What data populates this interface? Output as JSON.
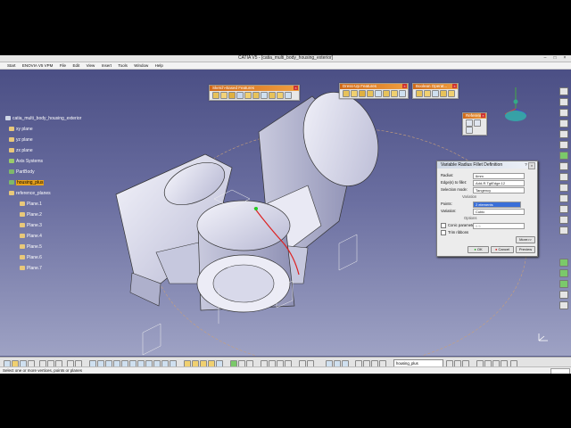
{
  "window": {
    "title": "CATIA V5 - [catia_multi_body_housing_exterior]"
  },
  "menu": [
    "Start",
    "ENOVIA V5 VPM",
    "File",
    "Edit",
    "View",
    "Insert",
    "Tools",
    "Window",
    "Help"
  ],
  "tree": {
    "root": "catia_multi_body_housing_exterior",
    "planes": [
      "xy plane",
      "yz plane",
      "zx plane"
    ],
    "axis_systems": "Axis Systems",
    "partbody": "PartBody",
    "housing": "housing_plus",
    "reference_planes": "reference_planes",
    "ref_plane_items": [
      "Plane.1",
      "Plane.2",
      "Plane.3",
      "Plane.4",
      "Plane.5",
      "Plane.6",
      "Plane.7"
    ]
  },
  "toolbars": {
    "sketch_based": "Sketch-Based Features",
    "dress_up": "Dress-Up Features",
    "boolean": "Boolean Operat...",
    "reference": "Reference ..."
  },
  "dialog": {
    "title": "Variable Radius Fillet Definition",
    "radius_label": "Radius:",
    "radius_value": "6mm",
    "edges_label": "Edge(s) to fillet:",
    "edges_value": "Add-R.TgtEdge.12",
    "propagation_label": "Selection mode:",
    "propagation_value": "Tangency",
    "variation_heading": "Variation",
    "points_label": "Points:",
    "points_value": "2 elements",
    "variation_label": "Variation:",
    "variation_value": "Cubic",
    "options_heading": "Options",
    "conic_label": "Conic parameter:",
    "conic_value": "0.5",
    "trim_label": "Trim ribbons",
    "more_label": "More>>",
    "ok_label": "OK",
    "cancel_label": "Cancel",
    "preview_label": "Preview"
  },
  "bottom": {
    "combo_value": "housing_plus"
  },
  "status_text": "Select one or more vertices, points or planes",
  "colors": {
    "viewport_top": "#4b4f85",
    "viewport_bottom": "#9ea2c4",
    "part": "#e4e4f0",
    "selected_node": "#e8a21a",
    "accent": "#d06a1a"
  }
}
